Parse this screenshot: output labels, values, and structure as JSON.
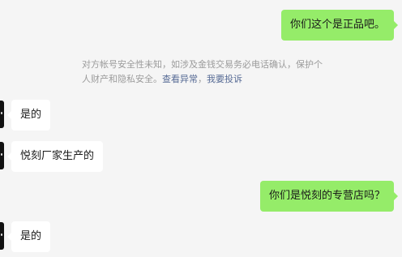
{
  "messages": [
    {
      "id": "m1",
      "side": "sent",
      "text": "你们这个是正品吧。"
    },
    {
      "id": "m2",
      "side": "recv",
      "text": "是的"
    },
    {
      "id": "m3",
      "side": "recv",
      "text": "悦刻厂家生产的"
    },
    {
      "id": "m4",
      "side": "sent",
      "text": "你们是悦刻的专营店吗？"
    },
    {
      "id": "m5",
      "side": "recv",
      "text": "是的"
    }
  ],
  "security_notice": {
    "text": "对方帐号安全性未知，如涉及金钱交易务必电话确认，保护个人财产和隐私安全。",
    "link_view_anomaly": "查看异常",
    "separator": "，",
    "link_report": "我要投诉"
  },
  "colors": {
    "background": "#f5f5f5",
    "sent_bubble": "#95ec69",
    "received_bubble": "#ffffff",
    "notice_text": "#9b9b9b",
    "link": "#576b95"
  }
}
